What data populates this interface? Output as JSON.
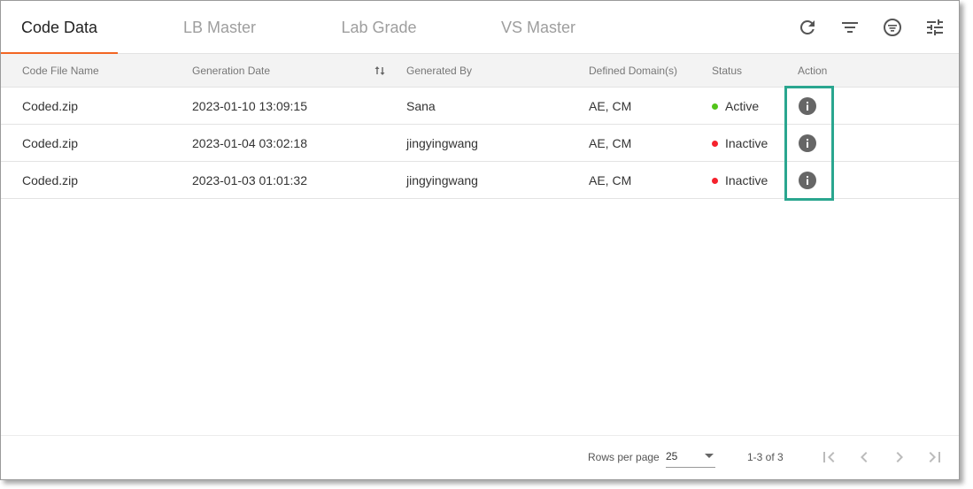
{
  "tabs": [
    {
      "label": "Code Data",
      "active": true
    },
    {
      "label": "LB Master",
      "active": false
    },
    {
      "label": "Lab Grade",
      "active": false
    },
    {
      "label": "VS Master",
      "active": false
    }
  ],
  "toolbar": {
    "icons": [
      "refresh-icon",
      "filter-icon",
      "filter-circle-icon",
      "tune-icon"
    ]
  },
  "table": {
    "columns": [
      "Code File Name",
      "Generation Date",
      "Generated By",
      "Defined Domain(s)",
      "Status",
      "Action"
    ],
    "rows": [
      {
        "file": "Coded.zip",
        "date": "2023-01-10 13:09:15",
        "by": "Sana",
        "domains": "AE, CM",
        "status": "Active"
      },
      {
        "file": "Coded.zip",
        "date": "2023-01-04 03:02:18",
        "by": "jingyingwang",
        "domains": "AE, CM",
        "status": "Inactive"
      },
      {
        "file": "Coded.zip",
        "date": "2023-01-03 01:01:32",
        "by": "jingyingwang",
        "domains": "AE, CM",
        "status": "Inactive"
      }
    ]
  },
  "colors": {
    "accent": "#f26522",
    "active": "#52c41a",
    "inactive": "#f5222d",
    "highlight": "#2aa68f",
    "icon": "#666666"
  },
  "footer": {
    "rows_per_page_label": "Rows per page",
    "rows_per_page_value": "25",
    "range": "1-3 of 3"
  }
}
